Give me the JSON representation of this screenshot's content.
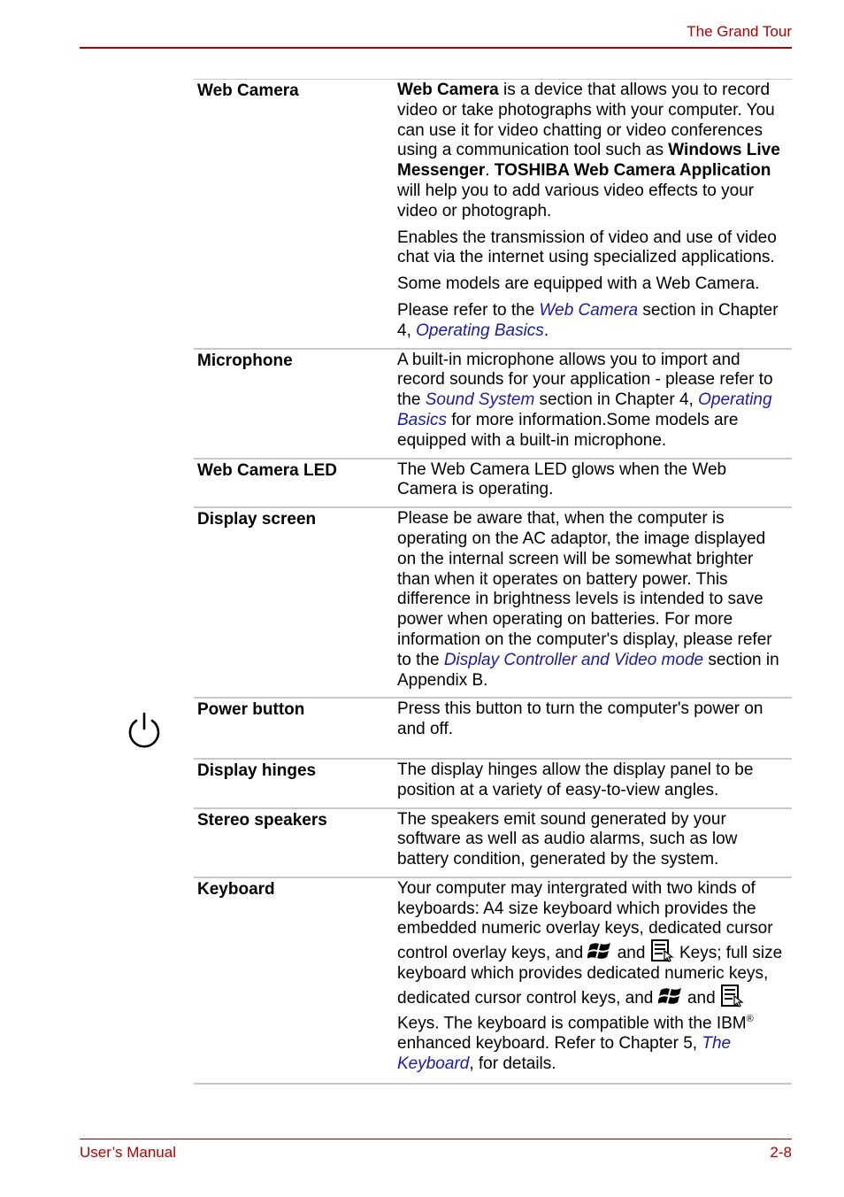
{
  "header": {
    "title": "The Grand Tour"
  },
  "footer": {
    "left": "User’s Manual",
    "right": "2-8"
  },
  "colors": {
    "accent": "#b00000",
    "link": "#1a1aa6",
    "rule": "#c8c8c8"
  },
  "rows": [
    {
      "term": "Web Camera",
      "p1": {
        "b1": "Web Camera",
        "t1": " is a device that allows you to record video or take photographs with your computer. You can use it for video chatting or video conferences using a communication tool such as ",
        "b2": "Windows Live Messenger",
        "t2": ". ",
        "b3": "TOSHIBA Web Camera Application",
        "t3": " will help you to add various video effects to your video or photograph."
      },
      "p2": "Enables the transmission of video and use of video chat via the internet using specialized applications.",
      "p3": "Some models are equipped with a Web Camera.",
      "p4": {
        "t1": "Please refer to the ",
        "l1": "Web Camera",
        "t2": " section in Chapter 4, ",
        "l2": "Operating Basics",
        "t3": "."
      }
    },
    {
      "term": "Microphone",
      "p1": {
        "t1": "A built-in microphone allows you to import and record sounds for your application - please refer to the ",
        "l1": "Sound System",
        "t2": " section in Chapter 4, ",
        "l2": "Operating Basics",
        "t3": " for more information.Some models are equipped with a built-in microphone."
      }
    },
    {
      "term": "Web Camera LED",
      "p1": "The Web Camera LED glows when the Web Camera is operating."
    },
    {
      "term": "Display screen",
      "p1": {
        "t1": "Please be aware that, when the computer is operating on the AC adaptor, the image displayed on the internal screen will be somewhat brighter than when it operates on battery power. This difference in brightness levels is intended to save power when operating on batteries. For more information on the computer's display, please refer to the ",
        "l1": "Display Controller and Video mode",
        "t2": " section in Appendix B."
      }
    },
    {
      "term": "Power button",
      "icon": "power-icon",
      "p1": "Press this button to turn the computer's power on and off."
    },
    {
      "term": "Display hinges",
      "p1": "The display hinges allow the display panel to be position at a variety of easy-to-view angles."
    },
    {
      "term": "Stereo speakers",
      "p1": "The speakers emit sound generated by your software as well as audio alarms, such as low battery condition, generated by the system."
    },
    {
      "term": "Keyboard",
      "p1": {
        "t1": "Your computer may intergrated with two kinds of keyboards: A4 size keyboard which provides the embedded numeric overlay keys, dedicated cursor control overlay keys, and ",
        "icon1": "windows-key-icon",
        "t2": " and ",
        "icon2": "application-key-icon",
        "t3": " Keys; full size keyboard which provides dedicated numeric keys, dedicated cursor control keys, and ",
        "t4": " and ",
        "t5": " Keys. The keyboard is compatible with the IBM",
        "sup": "®",
        "t6": " enhanced keyboard. Refer to Chapter 5, ",
        "l1": "The Keyboard",
        "t7": ", for details."
      }
    }
  ]
}
